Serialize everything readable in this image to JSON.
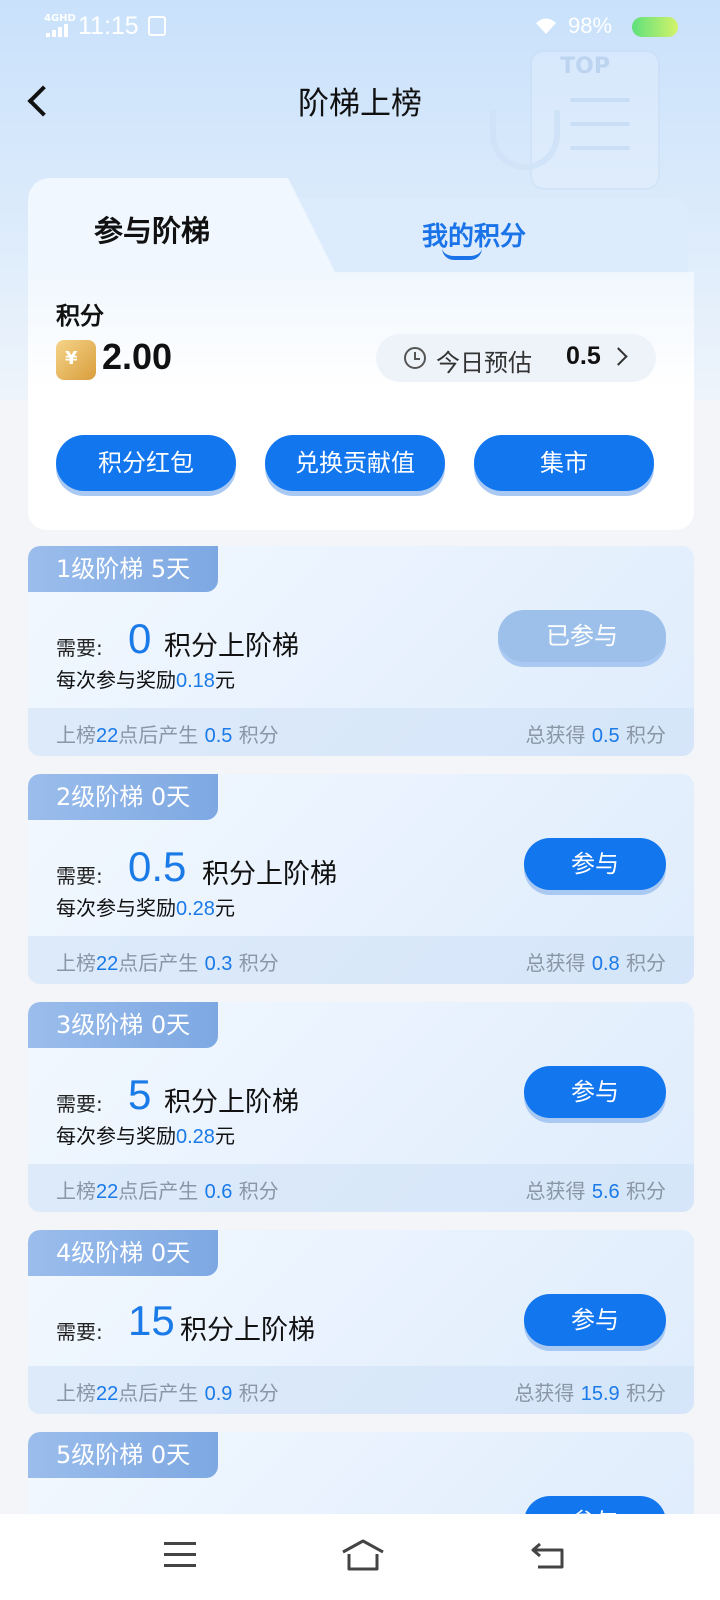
{
  "status_bar": {
    "network": "4GHD",
    "time": "11:15",
    "battery_pct": "98%"
  },
  "header": {
    "title": "阶梯上榜",
    "back_icon": "chevron-left-icon"
  },
  "tabs": [
    {
      "label": "参与阶梯",
      "active": true
    },
    {
      "label": "我的积分",
      "active": false
    }
  ],
  "points": {
    "label": "积分",
    "value": "2.00",
    "estimate_label": "今日预估",
    "estimate_value": "0.5"
  },
  "actions": [
    {
      "label": "积分红包"
    },
    {
      "label": "兑换贡献值"
    },
    {
      "label": "集市"
    }
  ],
  "tiers": [
    {
      "badge": "1级阶梯  5天",
      "need_label": "需要:",
      "need": "0",
      "need_suffix": "积分上阶梯",
      "reward_prefix": "每次参与奖励",
      "reward": "0.18",
      "reward_unit": "元",
      "button": "已参与",
      "joined": true,
      "footer_left_a": "上榜",
      "footer_hour": "22",
      "footer_left_b": "点后产生",
      "produce": "0.5",
      "unit": "积分",
      "total_label": "总获得",
      "total": "0.5"
    },
    {
      "badge": "2级阶梯  0天",
      "need_label": "需要:",
      "need": "0.5",
      "need_suffix": "积分上阶梯",
      "reward_prefix": "每次参与奖励",
      "reward": "0.28",
      "reward_unit": "元",
      "button": "参与",
      "joined": false,
      "footer_left_a": "上榜",
      "footer_hour": "22",
      "footer_left_b": "点后产生",
      "produce": "0.3",
      "unit": "积分",
      "total_label": "总获得",
      "total": "0.8"
    },
    {
      "badge": "3级阶梯  0天",
      "need_label": "需要:",
      "need": "5",
      "need_suffix": "积分上阶梯",
      "reward_prefix": "每次参与奖励",
      "reward": "0.28",
      "reward_unit": "元",
      "button": "参与",
      "joined": false,
      "footer_left_a": "上榜",
      "footer_hour": "22",
      "footer_left_b": "点后产生",
      "produce": "0.6",
      "unit": "积分",
      "total_label": "总获得",
      "total": "5.6"
    },
    {
      "badge": "4级阶梯  0天",
      "need_label": "需要:",
      "need": "15",
      "need_suffix": "积分上阶梯",
      "button": "参与",
      "joined": false,
      "footer_left_a": "上榜",
      "footer_hour": "22",
      "footer_left_b": "点后产生",
      "produce": "0.9",
      "unit": "积分",
      "total_label": "总获得",
      "total": "15.9"
    },
    {
      "badge": "5级阶梯  0天",
      "button": "参与",
      "joined": false
    }
  ],
  "bottom_nav": {
    "icons": [
      "menu-icon",
      "home-icon",
      "back-icon"
    ]
  }
}
